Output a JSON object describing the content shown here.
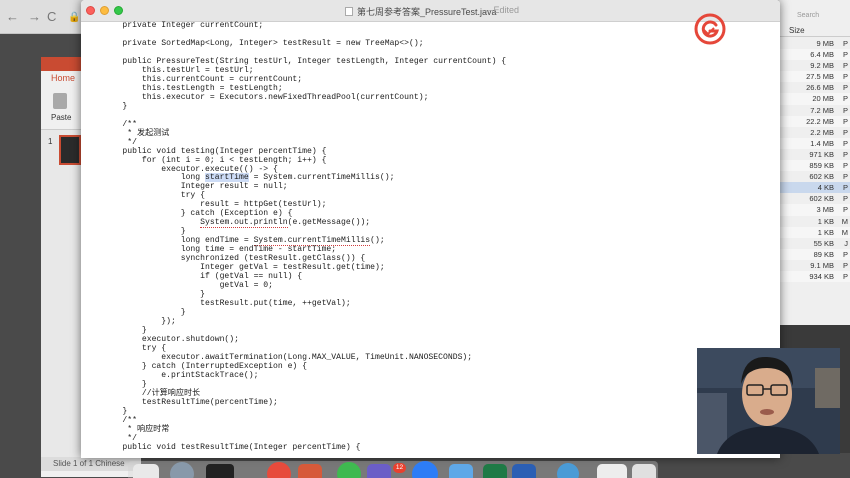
{
  "browser": {
    "back": "←",
    "forward": "→",
    "reload": "C",
    "lock": "🔒"
  },
  "ppt": {
    "tab_home": "Home",
    "paste_label": "Paste",
    "slide_number": "1",
    "status": "Slide 1 of 1    Chinese"
  },
  "finder": {
    "search_placeholder": "Search",
    "size_header": "Size",
    "rows": [
      {
        "size": "9 MB",
        "kind": "P"
      },
      {
        "size": "6.4 MB",
        "kind": "P"
      },
      {
        "size": "9.2 MB",
        "kind": "P"
      },
      {
        "size": "27.5 MB",
        "kind": "P"
      },
      {
        "size": "26.6 MB",
        "kind": "P"
      },
      {
        "size": "20 MB",
        "kind": "P"
      },
      {
        "size": "7.2 MB",
        "kind": "P"
      },
      {
        "size": "22.2 MB",
        "kind": "P"
      },
      {
        "size": "2.2 MB",
        "kind": "P"
      },
      {
        "size": "1.4 MB",
        "kind": "P"
      },
      {
        "size": "971 KB",
        "kind": "P"
      },
      {
        "size": "859 KB",
        "kind": "P"
      },
      {
        "size": "602 KB",
        "kind": "P"
      },
      {
        "size": "4 KB",
        "kind": "P"
      },
      {
        "size": "602 KB",
        "kind": "P"
      },
      {
        "size": "3 MB",
        "kind": "P"
      },
      {
        "size": "1 KB",
        "kind": "M"
      },
      {
        "size": "1 KB",
        "kind": "M"
      },
      {
        "size": "55 KB",
        "kind": "J"
      },
      {
        "size": "89 KB",
        "kind": "P"
      },
      {
        "size": "9.1 MB",
        "kind": "P"
      },
      {
        "size": "934 KB",
        "kind": "P"
      }
    ]
  },
  "editor": {
    "title": "第七周参考答案_PressureTest.java",
    "edited": "— Edited",
    "lines": [
      "    private Integer currentCount;",
      "",
      "    private SortedMap<Long, Integer> testResult = new TreeMap<>();",
      "",
      "    public PressureTest(String testUrl, Integer testLength, Integer currentCount) {",
      "        this.testUrl = testUrl;",
      "        this.currentCount = currentCount;",
      "        this.testLength = testLength;",
      "        this.executor = Executors.newFixedThreadPool(currentCount);",
      "    }",
      "",
      "    /**",
      "     * 发起测试",
      "     */",
      "    public void testing(Integer percentTime) {",
      "        for (int i = 0; i < testLength; i++) {",
      "            executor.execute(() -> {",
      "                long startTime = System.currentTimeMillis();",
      "                Integer result = null;",
      "                try {",
      "                    result = httpGet(testUrl);",
      "                } catch (Exception e) {",
      "                    System.out.println(e.getMessage());",
      "                }",
      "                long endTime = System.currentTimeMillis();",
      "                long time = endTime - startTime;",
      "                synchronized (testResult.getClass()) {",
      "                    Integer getVal = testResult.get(time);",
      "                    if (getVal == null) {",
      "                        getVal = 0;",
      "                    }",
      "                    testResult.put(time, ++getVal);",
      "                }",
      "            });",
      "        }",
      "        executor.shutdown();",
      "        try {",
      "            executor.awaitTermination(Long.MAX_VALUE, TimeUnit.NANOSECONDS);",
      "        } catch (InterruptedException e) {",
      "            e.printStackTrace();",
      "        }",
      "        //计算响应时长",
      "        testResultTime(percentTime);",
      "    }",
      "    /**",
      "     * 响应时常",
      "     */",
      "    public void testResultTime(Integer percentTime) {"
    ]
  },
  "dock": {
    "badge": "12"
  },
  "colors": {
    "close": "#fc605c",
    "minimize": "#fdbc40",
    "maximize": "#34c84a",
    "logo": "#e5473a",
    "selection": "#cddcf6"
  }
}
